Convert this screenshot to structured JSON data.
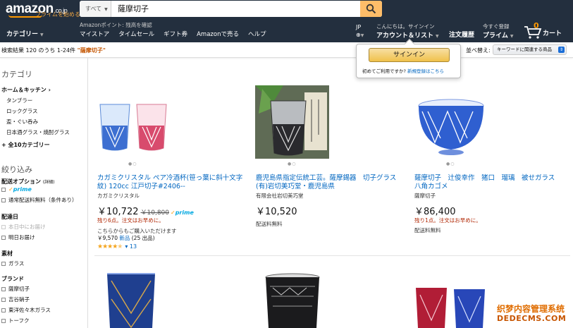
{
  "header": {
    "logo_text": "amazon",
    "logo_tld": ".co.jp",
    "logo_sub": "プライムを始める",
    "search_category": "すべて",
    "search_value": "薩摩切子",
    "promo": "Amazonポイント: 残高を確認",
    "category_label": "カテゴリー",
    "nav_links": [
      "マイストア",
      "タイムセール",
      "ギフト券",
      "Amazonで売る",
      "ヘルプ"
    ],
    "lang_top": "JP",
    "greeting": "こんにちは。サインイン",
    "account_label": "アカウント＆リスト",
    "orders_label": "注文履歴",
    "prime_top": "今すぐ登録",
    "prime_label": "プライム",
    "cart_count": "0",
    "cart_label": "カート"
  },
  "results": {
    "summary": "検索結果 120 のうち 1-24件 ",
    "query": "\"薩摩切子\"",
    "sort_label": "並べ替え:",
    "sort_value": "キーワードに関連する商品"
  },
  "popover": {
    "signin_label": "サインイン",
    "new_prefix": "初めてご利用ですか? ",
    "new_link": "新規登録はこちら"
  },
  "sidebar": {
    "category_heading": "カテゴリ",
    "category_main": "ホーム＆キッチン",
    "category_items": [
      "タンブラー",
      "ロックグラス",
      "盃・ぐい呑み",
      "日本酒グラス・焼酎グラス"
    ],
    "category_all": "+ 全10カテゴリー",
    "refine_heading": "絞り込み",
    "delivery_heading": "配送オプション",
    "delivery_note": "(詳細)",
    "prime_label": "prime",
    "free_shipping": "通常配送料無料（条件あり）",
    "ship_date_heading": "配達日",
    "ship_today": "本日中にお届け",
    "ship_tomorrow": "明日お届け",
    "material_heading": "素材",
    "material_glass": "ガラス",
    "brand_heading": "ブランド",
    "brands": [
      "薩摩切子",
      "吉谷硝子",
      "東洋佐々木ガラス",
      "トーフク"
    ]
  },
  "products": [
    {
      "title": "カガミクリスタル ペア冷酒杯(笹っ葉に斜十文字紋) 120cc 江戸切子#2406--",
      "brand": "カガミクリスタル",
      "price": "￥10,722",
      "old_price": "￥10,800",
      "prime": "prime",
      "stock": "残り6点。注文はお早めに。",
      "other_label": "こちらからもご購入いただけます",
      "other_price": "￥9,570",
      "other_link": "新品",
      "other_count": " (25 出品)",
      "rating": 4.5,
      "review_count": "13"
    },
    {
      "title": "鹿児島県指定伝統工芸。薩摩錫器　切子グラス(有)岩切美巧堂・鹿児島県",
      "brand": "有限会社岩切美巧堂",
      "price": "￥10,520",
      "shipping": "配送料無料"
    },
    {
      "title": "薩摩切子　辻俊幸作　猪口　瑠璃　被せガラス　八角カゴメ",
      "brand": "薩摩切子",
      "price": "￥86,400",
      "stock": "残り1点。注文はお早めに。",
      "shipping": "配送料無料"
    }
  ],
  "watermark": {
    "line1": "织梦内容管理系统",
    "line2": "DEDECMS.COM"
  },
  "colors": {
    "nav_bg": "#232f3e",
    "accent": "#febd69",
    "link": "#0066c0",
    "price_alert": "#b12704"
  }
}
